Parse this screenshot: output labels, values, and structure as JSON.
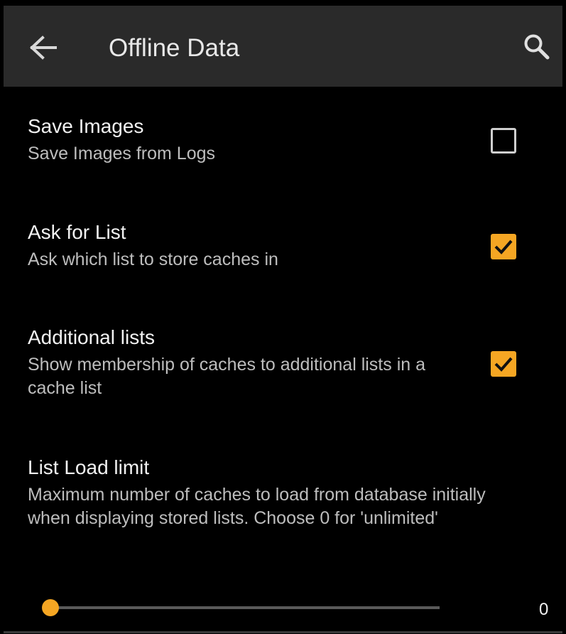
{
  "appbar": {
    "title": "Offline Data",
    "back_icon": "arrow-left-icon",
    "search_icon": "search-icon"
  },
  "preferences": [
    {
      "title": "Save Images",
      "summary": "Save Images from Logs",
      "checked": false
    },
    {
      "title": "Ask for List",
      "summary": "Ask which list to store caches in",
      "checked": true
    },
    {
      "title": "Additional lists",
      "summary": "Show membership of caches to additional lists in a cache list",
      "checked": true
    },
    {
      "title": "List Load limit",
      "summary": "Maximum number of caches to load from database initially when displaying stored lists. Choose 0 for 'unlimited'"
    }
  ],
  "load_limit": {
    "value": "0",
    "slider_fraction": 0
  },
  "colors": {
    "accent": "#f5a623",
    "appbar": "#2a2a2a",
    "background": "#000000"
  }
}
